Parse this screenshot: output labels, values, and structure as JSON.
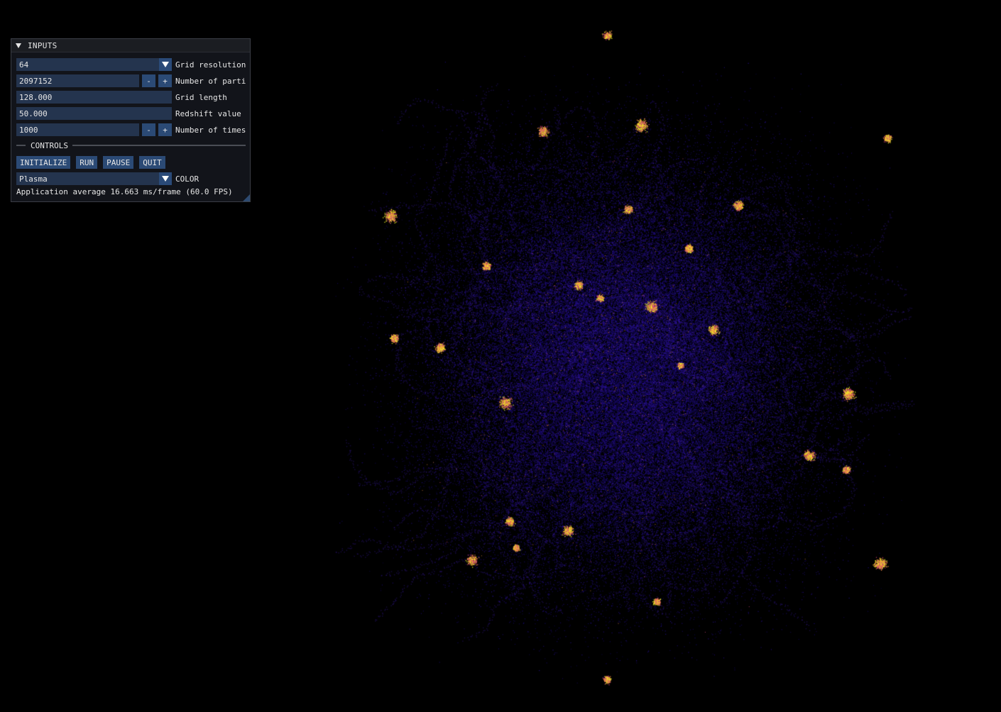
{
  "panel": {
    "title": "INPUTS",
    "grid_resolution": {
      "value": "64",
      "label": "Grid resolution"
    },
    "num_particles": {
      "value": "2097152",
      "label": "Number of parti",
      "dec": "-",
      "inc": "+"
    },
    "grid_length": {
      "value": "128.000",
      "label": "Grid length"
    },
    "redshift": {
      "value": "50.000",
      "label": "Redshift value"
    },
    "num_timesteps": {
      "value": "1000",
      "label": "Number of times",
      "dec": "-",
      "inc": "+"
    },
    "controls_header": "CONTROLS",
    "buttons": {
      "initialize": "INITIALIZE",
      "run": "RUN",
      "pause": "PAUSE",
      "quit": "QUIT"
    },
    "color": {
      "value": "Plasma",
      "label": "COLOR"
    },
    "stats": "Application average 16.663 ms/frame (60.0 FPS)"
  },
  "colors": {
    "background": "#000000",
    "field_bg": "#24344e",
    "button_bg": "#2b4a75",
    "particles_base": "#2a1a8a",
    "particles_hot": "#f0f921"
  },
  "icons": {
    "collapse": "triangle-down-icon",
    "combo_arrow": "chevron-down-icon"
  }
}
